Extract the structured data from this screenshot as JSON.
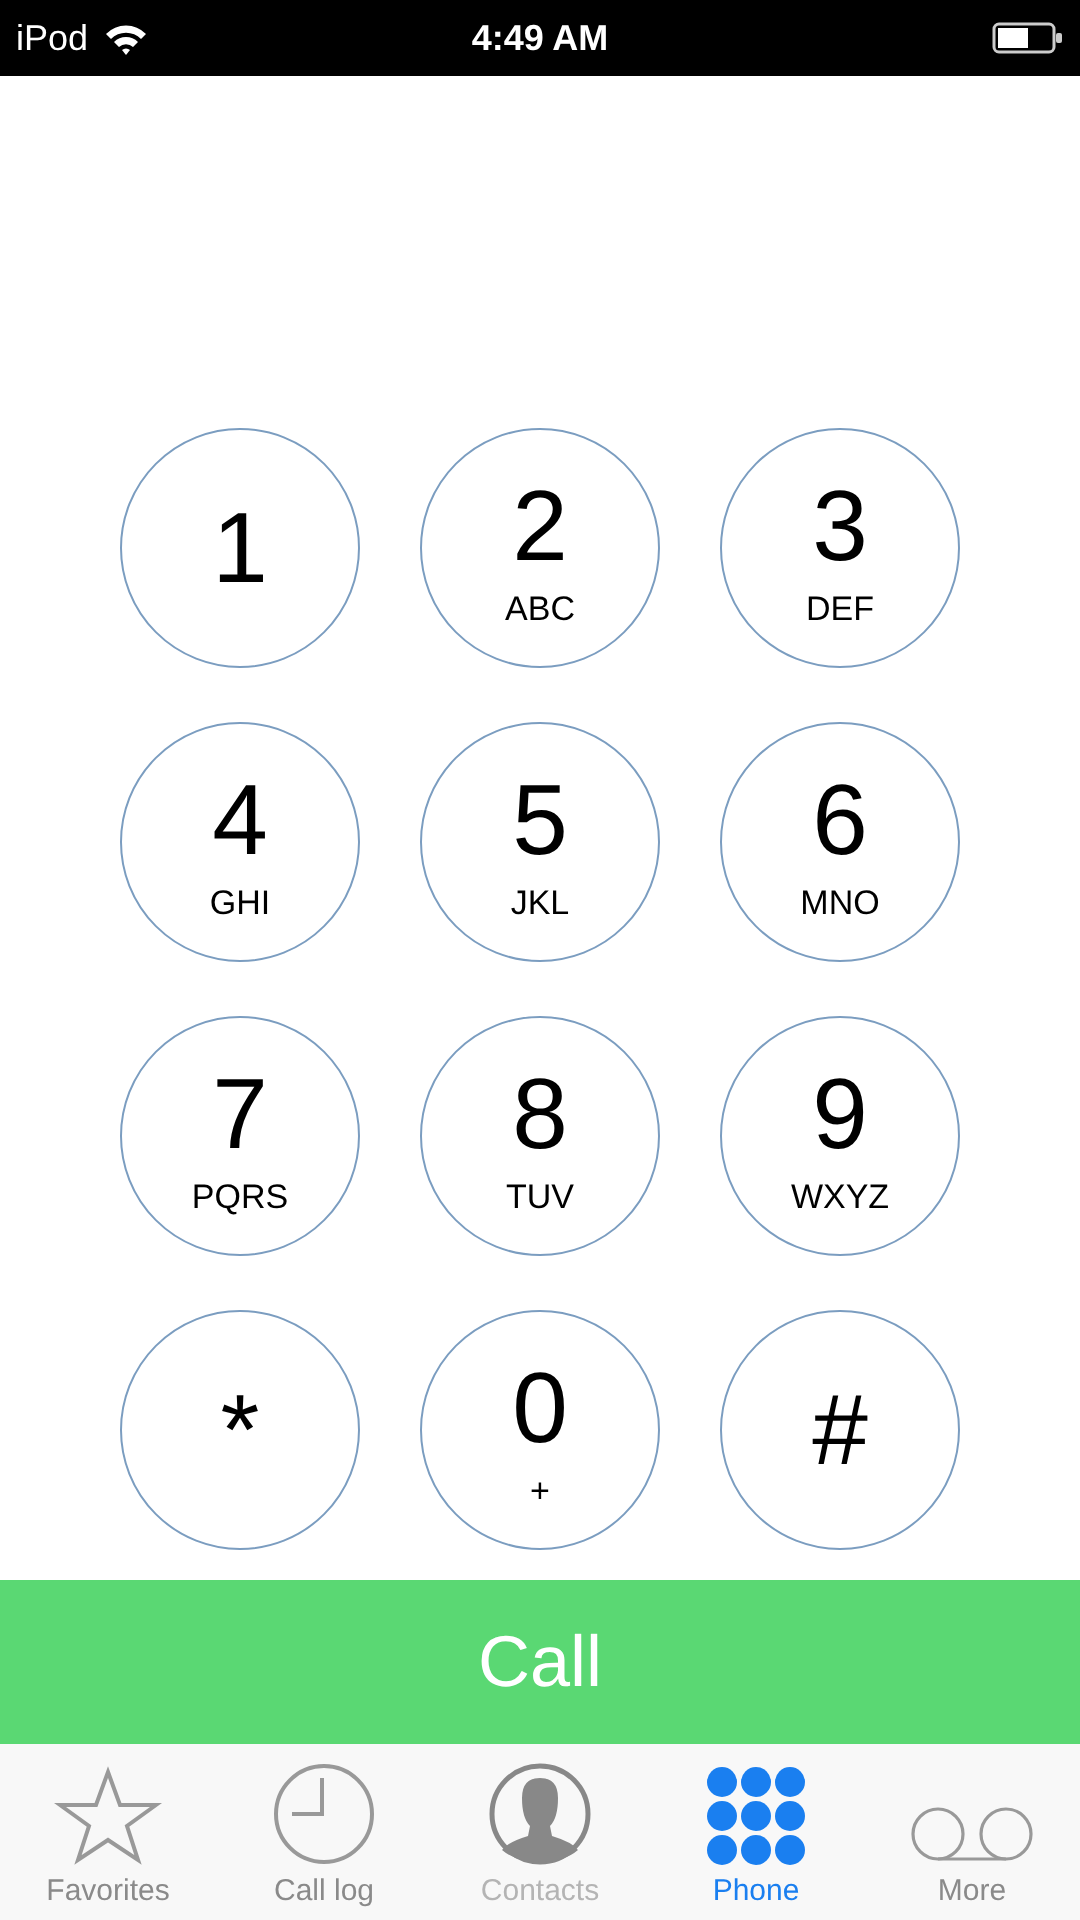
{
  "status_bar": {
    "carrier": "iPod",
    "time": "4:49 AM"
  },
  "keypad": [
    {
      "digit": "1"
    },
    {
      "digit": "2",
      "letters": "ABC"
    },
    {
      "digit": "3",
      "letters": "DEF"
    },
    {
      "digit": "4",
      "letters": "GHI"
    },
    {
      "digit": "5",
      "letters": "JKL"
    },
    {
      "digit": "6",
      "letters": "MNO"
    },
    {
      "digit": "7",
      "letters": "PQRS"
    },
    {
      "digit": "8",
      "letters": "TUV"
    },
    {
      "digit": "9",
      "letters": "WXYZ"
    },
    {
      "digit": "*"
    },
    {
      "digit": "0",
      "letters": "+"
    },
    {
      "digit": "#"
    }
  ],
  "call_button": "Call",
  "tabs": [
    {
      "label": "Favorites",
      "kind": "star",
      "selected": false,
      "disabled": false
    },
    {
      "label": "Call log",
      "kind": "clock",
      "selected": false,
      "disabled": false
    },
    {
      "label": "Contacts",
      "kind": "person",
      "selected": false,
      "disabled": true
    },
    {
      "label": "Phone",
      "kind": "keypad",
      "selected": true,
      "disabled": false
    },
    {
      "label": "More",
      "kind": "voicemail",
      "selected": false,
      "disabled": false
    }
  ]
}
